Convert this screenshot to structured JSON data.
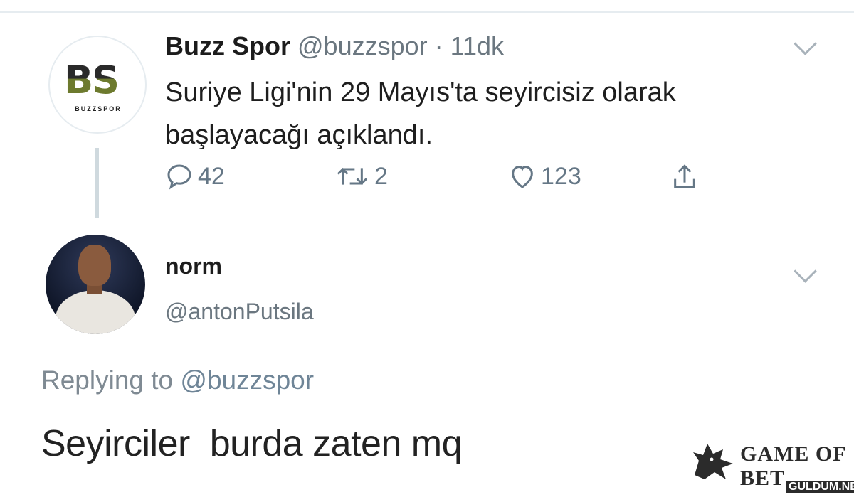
{
  "tweet": {
    "author_name": "Buzz Spor",
    "handle": "@buzzspor",
    "separator": " · ",
    "time": "11dk",
    "text": "Suriye Ligi'nin 29 Mayıs'ta seyircisiz olarak başlayacağı açıklandı.",
    "avatar": {
      "mark": "BS",
      "sub": "BUZZSPOR"
    },
    "actions": {
      "replies": "42",
      "retweets": "2",
      "likes": "123"
    }
  },
  "reply": {
    "author_name": "norm",
    "handle": "@antonPutsila",
    "replying_prefix": "Replying to ",
    "replying_to": "@buzzspor",
    "text": "Seyirciler  burda zaten mq"
  },
  "watermark": {
    "title": "GAME OF BET",
    "sub": "GULDUM.NET"
  },
  "colors": {
    "text": "#14171a",
    "muted": "#657786",
    "thread_line": "#cfd9de",
    "brand_green": "#6d7a2e"
  }
}
